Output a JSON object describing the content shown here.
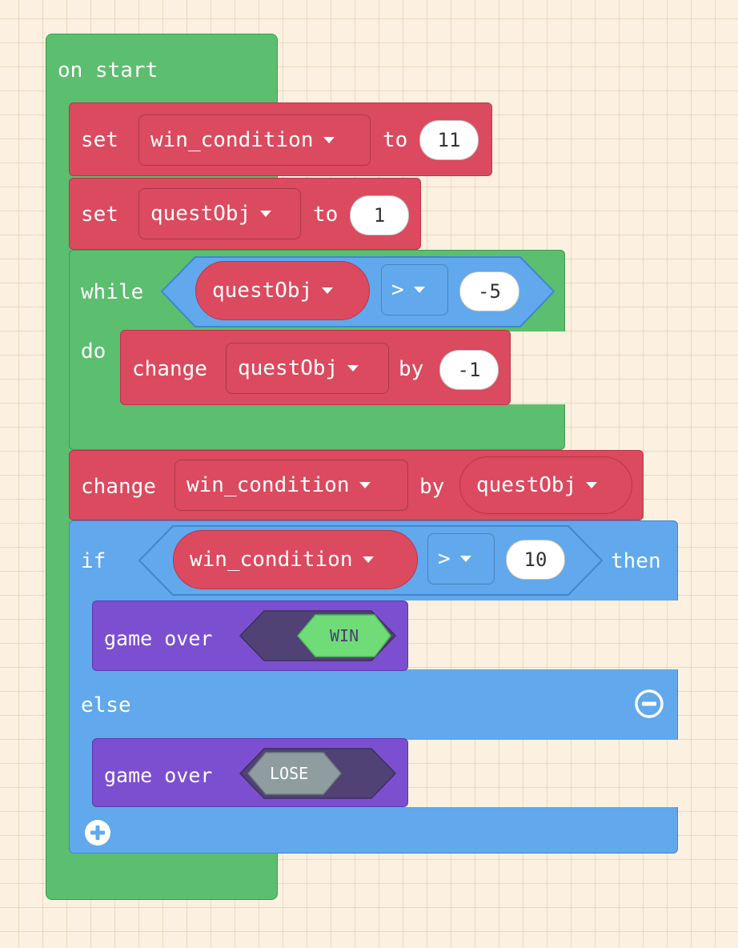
{
  "event_block": {
    "label": "on start"
  },
  "set_win": {
    "keyword": "set",
    "variable": "win_condition",
    "to": "to",
    "value": "11"
  },
  "set_quest": {
    "keyword": "set",
    "variable": "questObj",
    "to": "to",
    "value": "1"
  },
  "while_block": {
    "keyword": "while",
    "do_label": "do",
    "condition": {
      "variable": "questObj",
      "operator": ">",
      "value": "-5"
    }
  },
  "change_quest": {
    "keyword": "change",
    "variable": "questObj",
    "by": "by",
    "value": "-1"
  },
  "change_win": {
    "keyword": "change",
    "variable": "win_condition",
    "by": "by",
    "value_variable": "questObj"
  },
  "if_block": {
    "keyword": "if",
    "then": "then",
    "else": "else",
    "condition": {
      "variable": "win_condition",
      "operator": ">",
      "value": "10"
    }
  },
  "game_over_win": {
    "label": "game over",
    "result": "WIN"
  },
  "game_over_lose": {
    "label": "game over",
    "result": "LOSE"
  },
  "colors": {
    "events": "#5cbe6f",
    "variables": "#db4a5e",
    "logic": "#61a8ec",
    "game": "#7c4fd0",
    "win": "#6fdc78",
    "lose": "#8f9d9f"
  },
  "icons": {
    "remove": "minus-circle-icon",
    "add": "plus-circle-icon",
    "dropdown": "caret-down-icon"
  }
}
